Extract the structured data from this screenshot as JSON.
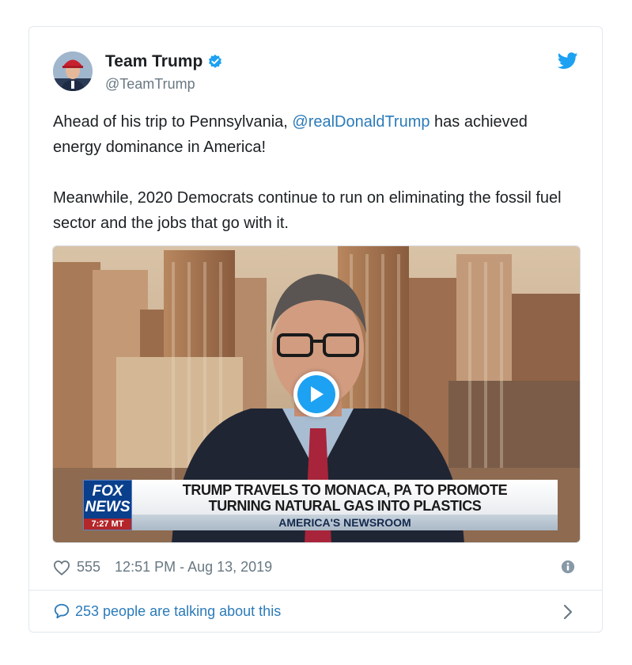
{
  "tweet": {
    "display_name": "Team Trump",
    "handle": "@TeamTrump",
    "verified": true,
    "text_part1": "Ahead of his trip to Pennsylvania, ",
    "mention": "@realDonaldTrump",
    "text_part2": " has achieved energy dominance in America!",
    "text_paragraph2": "Meanwhile, 2020 Democrats continue to run on eliminating the fossil fuel sector and the jobs that go with it."
  },
  "media": {
    "network_logo_line1": "FOX",
    "network_logo_line2": "NEWS",
    "network_time": "7:27 MT",
    "chyron_line1": "TRUMP TRAVELS TO MONACA, PA TO PROMOTE",
    "chyron_line2": "TURNING NATURAL GAS INTO PLASTICS",
    "chyron_sub": "AMERICA'S NEWSROOM"
  },
  "meta": {
    "likes": "555",
    "timestamp": "12:51 PM - Aug 13, 2019"
  },
  "footer": {
    "talking_label": "253 people are talking about this"
  },
  "colors": {
    "link": "#2b7bb9",
    "twitter_blue": "#1da1f2",
    "muted": "#697882"
  },
  "icons": {
    "verified": "verified-badge-icon",
    "bird": "twitter-bird-icon",
    "play": "play-icon",
    "heart": "heart-icon",
    "info": "info-icon",
    "bubble": "speech-bubble-icon",
    "chevron": "chevron-right-icon"
  }
}
